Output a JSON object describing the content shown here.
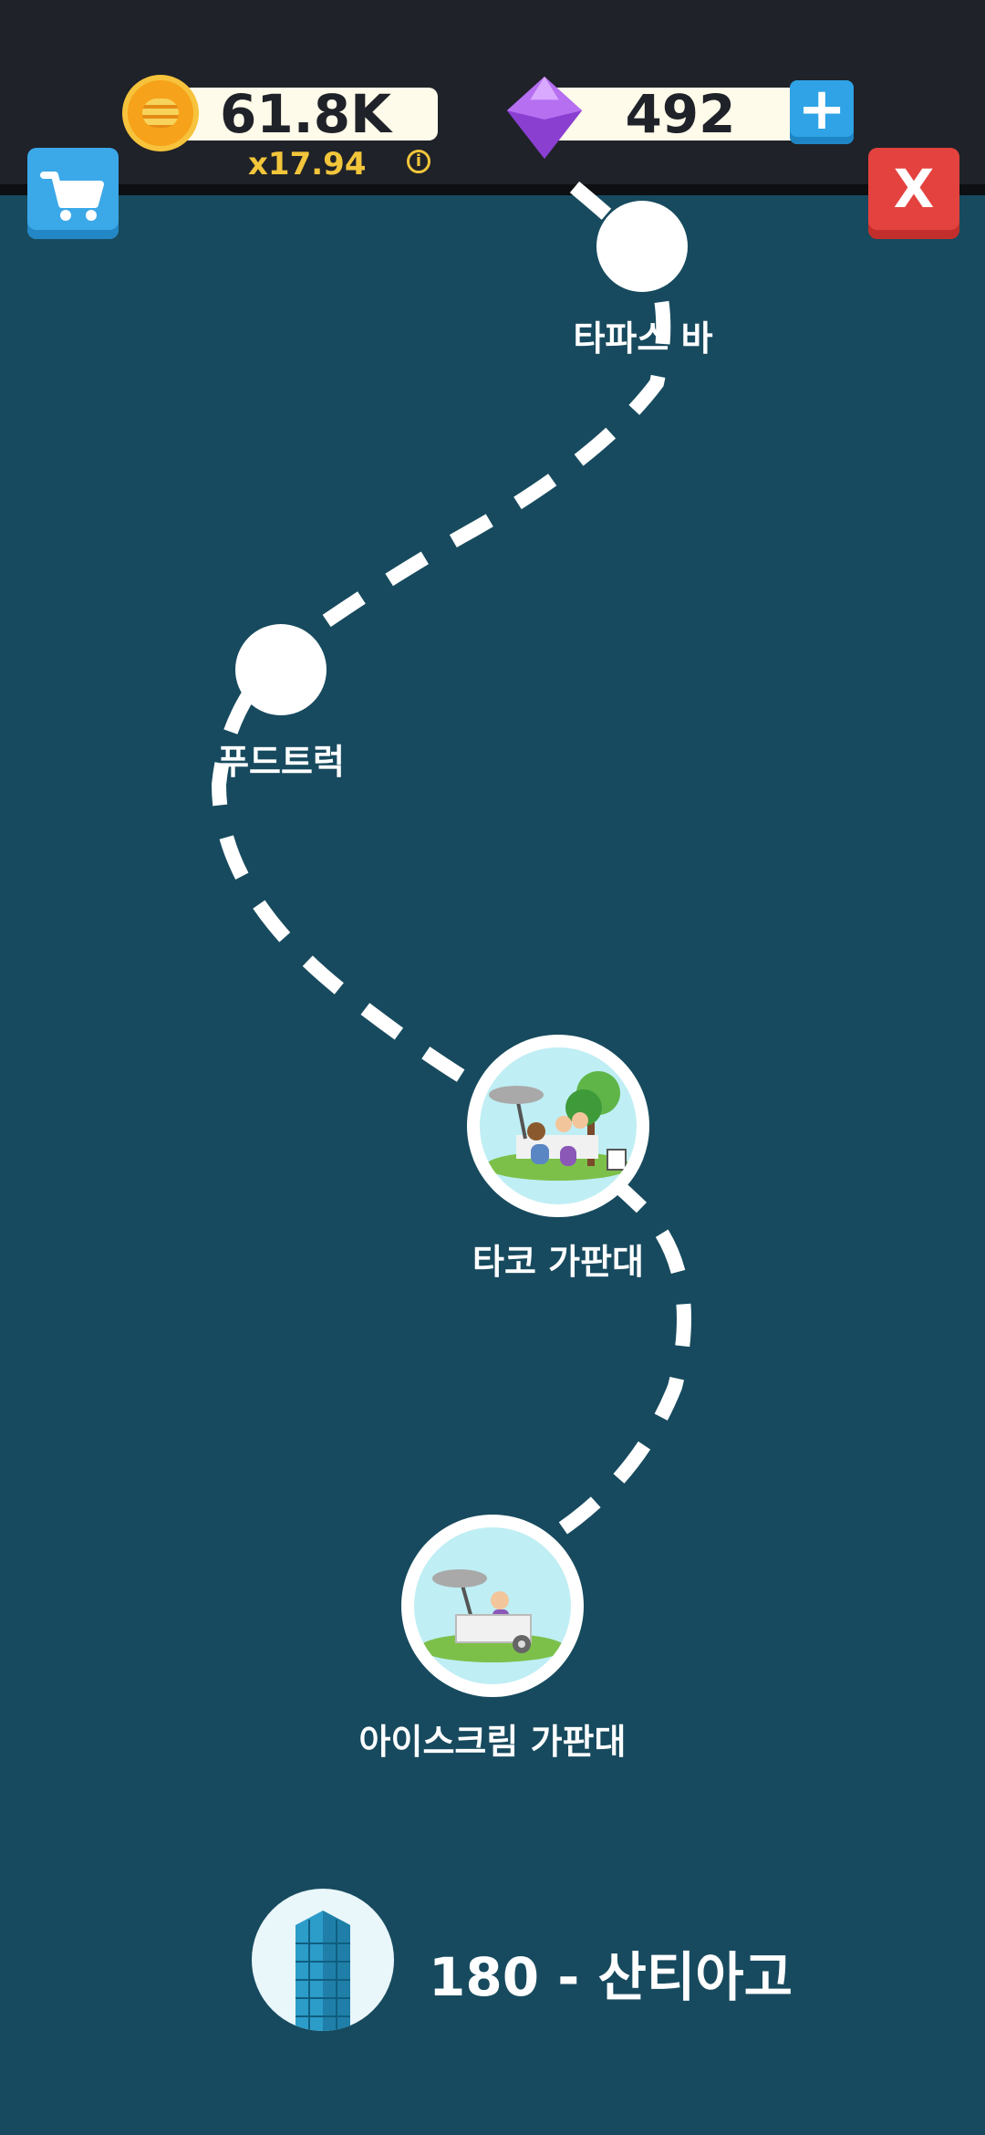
{
  "header": {
    "coins": "61.8K",
    "multiplier": "x17.94",
    "gems": "492",
    "plus_label": "+",
    "info_label": "i",
    "close_label": "X"
  },
  "path": {
    "stops": [
      {
        "label": "타파스 바"
      },
      {
        "label": "푸드트럭"
      },
      {
        "label": "타코 가판대"
      },
      {
        "label": "아이스크림 가판대"
      }
    ]
  },
  "current_city": {
    "label": "180 - 산티아고"
  },
  "colors": {
    "background": "#174a5e",
    "topbar": "#1f2228",
    "accent_blue": "#3ba8e8",
    "accent_red": "#e4423f",
    "gold": "#f2c53b"
  }
}
